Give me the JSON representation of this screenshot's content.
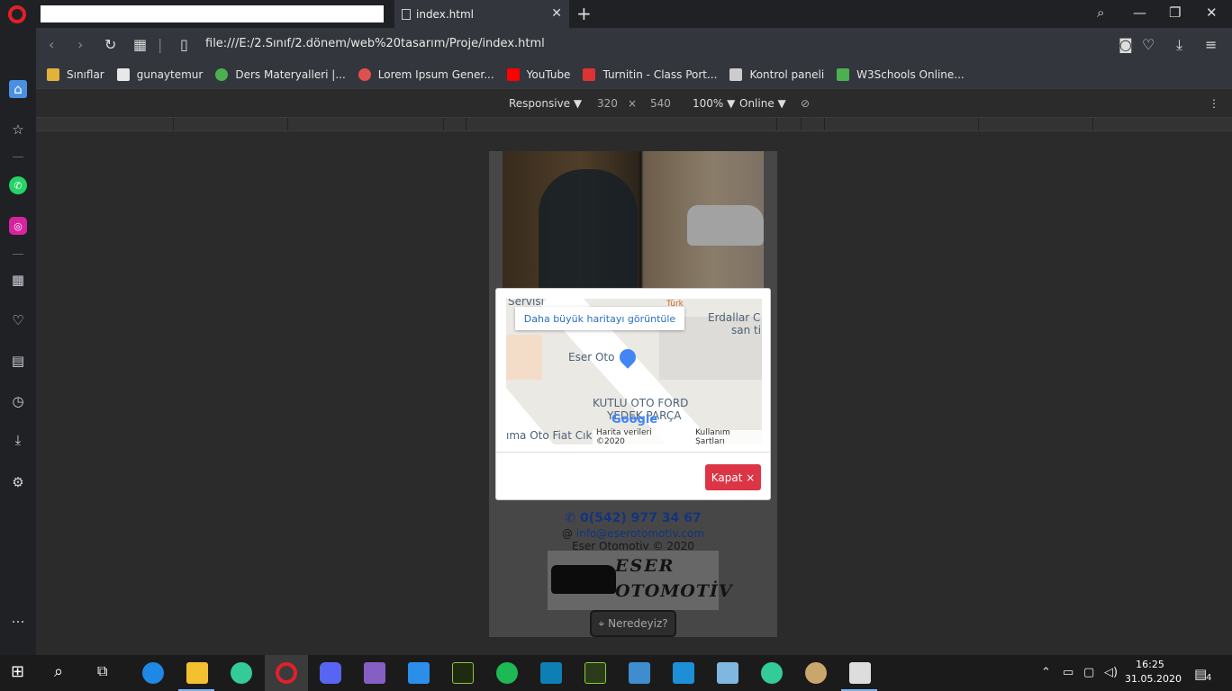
{
  "tab": {
    "title": "index.html",
    "close": "✕",
    "new_tab": "+"
  },
  "window": {
    "minimize": "—",
    "restore": "❐",
    "close": "✕"
  },
  "address": {
    "url": "file:///E:/2.Sınıf/2.dönem/web%20tasarım/Proje/index.html"
  },
  "bookmarks": [
    {
      "label": "Sınıflar",
      "color": "#e2b33a"
    },
    {
      "label": "gunaytemur",
      "color": "#e8e8e8"
    },
    {
      "label": "Ders Materyalleri |...",
      "color": "#4caf50"
    },
    {
      "label": "Lorem Ipsum Gener...",
      "color": "#e05050"
    },
    {
      "label": "YouTube",
      "color": "#ff0000"
    },
    {
      "label": "Turnitin - Class Port...",
      "color": "#d33"
    },
    {
      "label": "Kontrol paneli",
      "color": "#ccc"
    },
    {
      "label": "W3Schools Online...",
      "color": "#4caf50"
    }
  ],
  "devtools": {
    "mode": "Responsive ▼",
    "width": "320",
    "times": "×",
    "height": "540",
    "zoom": "100% ▼",
    "network": "Online ▼"
  },
  "page": {
    "phone": "✆ 0(542) 977 34 67",
    "email_prefix": "@",
    "email": "info@eserotomotiv.com",
    "copyright": "Eser Otomotiv © 2020",
    "logo_line1": "ESER",
    "logo_line2": "OTOMOTİV",
    "where_button": "Neredeyiz?"
  },
  "modal": {
    "map_link": "Daha büyük haritayı görüntüle",
    "labels": {
      "servisi": "Servisi",
      "turk": "Türk",
      "erdallar1": "Erdallar C",
      "erdallar2": "san ti",
      "eser_oto": "Eser Oto",
      "kutlu1": "KUTLU OTO FORD",
      "kutlu2": "YEDEK PARÇA",
      "fiat": "ıma Oto Fiat Cık"
    },
    "google": "Google",
    "map_data": "Harita verileri ©2020",
    "terms": "Kullanım Şartları",
    "close_button": "Kapat ×"
  },
  "taskbar": {
    "time": "16:25",
    "date": "31.05.2020",
    "notifications": "4"
  }
}
